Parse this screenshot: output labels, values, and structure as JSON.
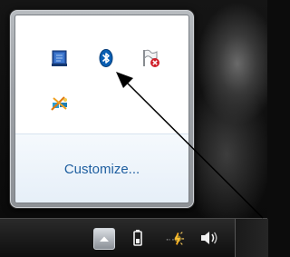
{
  "flyout": {
    "customize_label": "Customize...",
    "icons": [
      "network-adapter-icon",
      "bluetooth-icon",
      "action-center-flag-icon",
      "network-disconnected-icon"
    ]
  },
  "taskbar": {
    "icons": [
      "show-hidden-icons-arrow",
      "battery-icon",
      "power-plug-icon",
      "speaker-icon"
    ]
  },
  "colors": {
    "link": "#1f5fa0",
    "bluetooth": "#0a5fb3",
    "error_badge": "#d0202a"
  }
}
